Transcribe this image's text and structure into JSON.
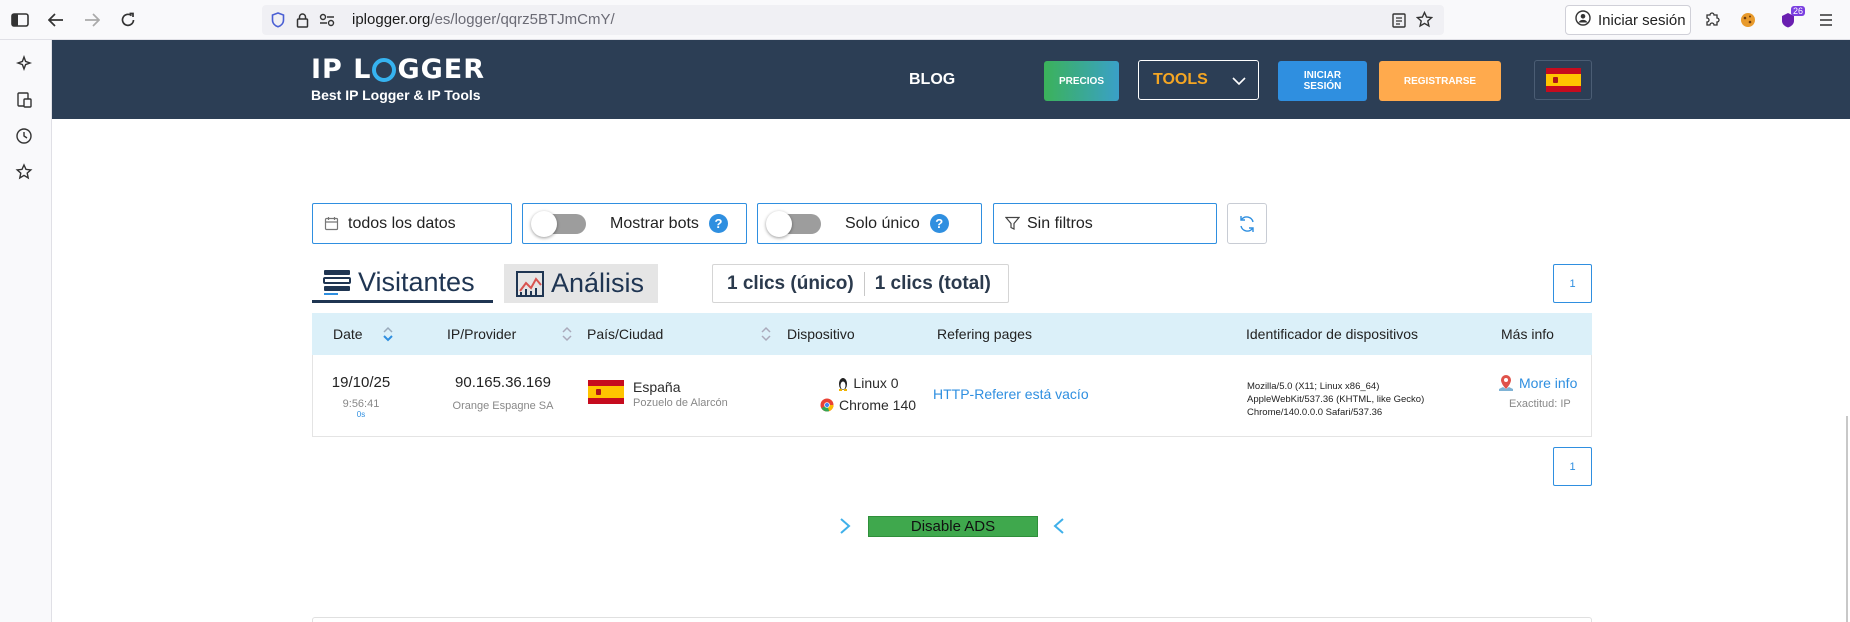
{
  "browser": {
    "url_host": "iplogger.org",
    "url_path": "/es/logger/qqrz5BTJmCmY/",
    "signin_label": "Iniciar sesión",
    "extension_badge": "26"
  },
  "header": {
    "logo_left": "IP L",
    "logo_right": "GGER",
    "logo_subtitle": "Best IP Logger & IP Tools",
    "nav_blog": "BLOG",
    "precios": "PRECIOS",
    "tools": "TOOLS",
    "login_line1": "INICIAR",
    "login_line2": "SESIÓN",
    "register": "REGISTRARSE"
  },
  "filters": {
    "date_range": "todos los datos",
    "show_bots": "Mostrar bots",
    "unique_only": "Solo único",
    "no_filters": "Sin filtros",
    "help_glyph": "?"
  },
  "tabs": {
    "visitors": "Visitantes",
    "analysis": "Análisis"
  },
  "clicks": {
    "unique": "1 clics (único)",
    "total": "1 clics (total)"
  },
  "pagination": {
    "page": "1"
  },
  "table": {
    "headers": {
      "date": "Date",
      "ip": "IP/Provider",
      "country": "País/Ciudad",
      "device": "Dispositivo",
      "referer": "Refering pages",
      "device_id": "Identificador de dispositivos",
      "more": "Más info"
    },
    "row": {
      "date": "19/10/25",
      "time": "9:56:41",
      "duration": "0s",
      "ip": "90.165.36.169",
      "provider": "Orange Espagne SA",
      "country": "España",
      "city": "Pozuelo de Alarcón",
      "os": "Linux 0",
      "browser": "Chrome 140",
      "referer": "HTTP-Referer está vacío",
      "ua_line1": "Mozilla/5.0 (X11; Linux x86_64)",
      "ua_line2": "AppleWebKit/537.36 (KHTML, like Gecko)",
      "ua_line3": "Chrome/140.0.0.0 Safari/537.36",
      "more_info": "More info",
      "accuracy": "Exactitud: IP"
    }
  },
  "ads": {
    "disable": "Disable ADS"
  },
  "colors": {
    "header_bg": "#2c3e55",
    "accent_blue": "#2f8fe0",
    "tools_orange": "#f5a623",
    "register_orange": "#ffaa4d",
    "table_head_bg": "#dbf0f9"
  }
}
